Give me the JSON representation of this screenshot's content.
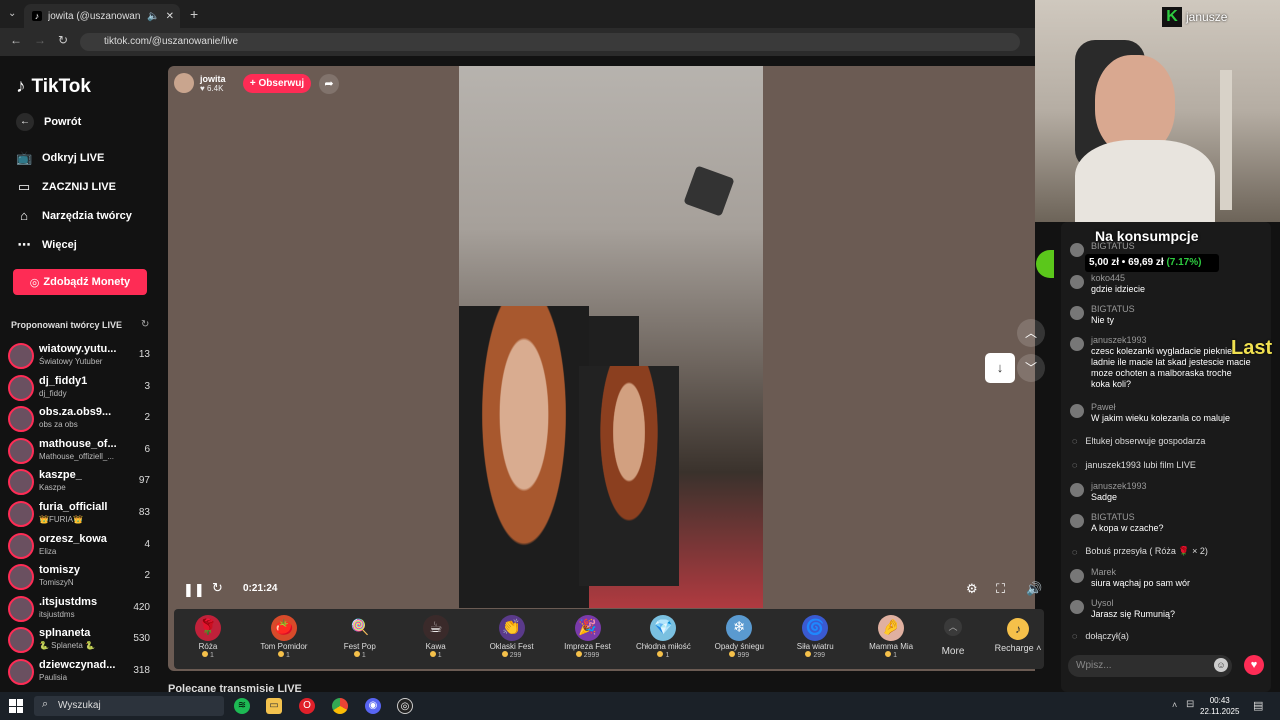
{
  "browser": {
    "tab_title": "jowita (@uszanowanie) pro...",
    "url": "tiktok.com/@uszanowanie/live"
  },
  "sidebar": {
    "logo": "TikTok",
    "back": "Powrót",
    "nav": [
      {
        "label": "Odkryj LIVE",
        "icon": "live-tv-icon"
      },
      {
        "label": "ZACZNIJ LIVE",
        "icon": "video-camera-icon"
      },
      {
        "label": "Narzędzia twórcy",
        "icon": "home-icon"
      },
      {
        "label": "Więcej",
        "icon": "more-icon"
      }
    ],
    "coins_button": "Zdobądź Monety",
    "proposed_title": "Proponowani twórcy LIVE",
    "creators": [
      {
        "name": "wiatowy.yutu...",
        "sub": "Światowy Yutuber",
        "count": "13"
      },
      {
        "name": "dj_fiddy1",
        "sub": "dj_fiddy",
        "count": "3"
      },
      {
        "name": "obs.za.obs9...",
        "sub": "obs za obs",
        "count": "2"
      },
      {
        "name": "mathouse_of...",
        "sub": "Mathouse_offiziell_...",
        "count": "6"
      },
      {
        "name": "kaszpe_",
        "sub": "Kaszpe",
        "count": "97"
      },
      {
        "name": "furia_officiall",
        "sub": "👑FURIA👑",
        "count": "83"
      },
      {
        "name": "orzesz_kowa",
        "sub": "Eliza",
        "count": "4"
      },
      {
        "name": "tomiszy",
        "sub": "TomiszyN",
        "count": "2"
      },
      {
        "name": ".itsjustdms",
        "sub": "itsjustdms",
        "count": "420"
      },
      {
        "name": "splnaneta",
        "sub": "🐍 Splaneta 🐍",
        "count": "530"
      },
      {
        "name": "dziewczynad...",
        "sub": "Paulisia",
        "count": "318"
      }
    ],
    "recommended": "Polecane transmisje LIVE"
  },
  "player": {
    "host_name": "jowita",
    "host_likes": "6.4K",
    "follow": "+ Obserwuj",
    "time": "0:21:24"
  },
  "gifts": [
    {
      "name": "Róża",
      "price": "1",
      "icon": "🌹",
      "color": "#c0213a"
    },
    {
      "name": "Tom Pomidor",
      "price": "1",
      "icon": "🍅",
      "color": "#d84a2a"
    },
    {
      "name": "Fest Pop",
      "price": "1",
      "icon": "🍭",
      "color": "#2a2a2a"
    },
    {
      "name": "Kawa",
      "price": "1",
      "icon": "☕",
      "color": "#3a2a2a"
    },
    {
      "name": "Oklaski Fest",
      "price": "299",
      "icon": "👏",
      "color": "#5a3a8a"
    },
    {
      "name": "Impreza Fest",
      "price": "2999",
      "icon": "🎉",
      "color": "#7a3aaa"
    },
    {
      "name": "Chłodna miłość",
      "price": "1",
      "icon": "💎",
      "color": "#7ac0e0"
    },
    {
      "name": "Opady śniegu",
      "price": "999",
      "icon": "❄",
      "color": "#5a9ad0"
    },
    {
      "name": "Siła wiatru",
      "price": "299",
      "icon": "🌀",
      "color": "#3a5ad0"
    },
    {
      "name": "Mamma Mia",
      "price": "1",
      "icon": "🤌",
      "color": "#e0b0a0"
    }
  ],
  "more_label": "More",
  "recharge_label": "Recharge",
  "webcam": {
    "logo_name": "janusze"
  },
  "overlay": {
    "title": "Na konsumpcje",
    "price": "5,00 zł • 69,69 zł",
    "percent": "(7.17%)",
    "last": "Last"
  },
  "chat": [
    {
      "user": "BIGTATUS",
      "text": ""
    },
    {
      "user": "koko445",
      "text": "gdzie idziecie"
    },
    {
      "user": "BIGTATUS",
      "text": "Nie ty"
    },
    {
      "user": "januszek1993",
      "text": "czesc kolezanki wygladacie pieknie ladnie ile macie lat skad jestescie macie moze ochoten a malboraska troche koka koli?"
    },
    {
      "user": "Paweł",
      "text": "W jakim wieku kolezanla co maluje"
    },
    {
      "event": "Eltukej  obserwuje gospodarza"
    },
    {
      "event": "januszek1993 lubi film LIVE"
    },
    {
      "user": "januszek1993",
      "text": "Sadge"
    },
    {
      "user": "BIGTATUS",
      "text": "A kopa w czache?"
    },
    {
      "event": "Bobuś przesyła ( Róża 🌹 × 2)"
    },
    {
      "user": "Marek",
      "text": "siura wąchaj po sam wór"
    },
    {
      "user": "Uysol",
      "text": "Jarasz się Rumunią?"
    },
    {
      "event": "dołączył(a)"
    }
  ],
  "chat_placeholder": "Wpisz...",
  "taskbar": {
    "search": "Wyszukaj",
    "time": "00:43",
    "date": "22.11.2025"
  }
}
